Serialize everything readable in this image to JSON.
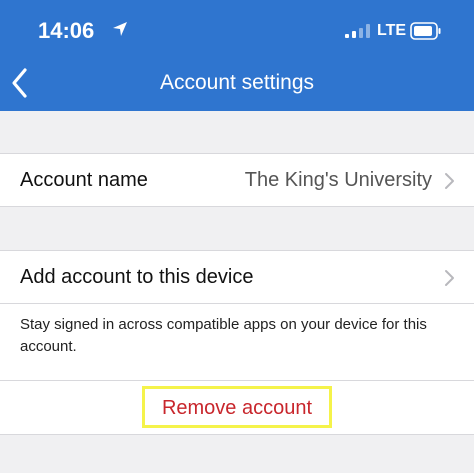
{
  "status_bar": {
    "time": "14:06",
    "network": "LTE"
  },
  "header": {
    "title": "Account settings"
  },
  "account_name_row": {
    "label": "Account name",
    "value": "The King's University"
  },
  "add_account_row": {
    "label": "Add account to this device"
  },
  "note": {
    "text": "Stay signed in across compatible apps on your device for this account."
  },
  "remove": {
    "label": "Remove account"
  },
  "colors": {
    "header_bg": "#2f75cf",
    "remove_text": "#c8262c",
    "highlight": "#f5f34a"
  },
  "icons": [
    "location-arrow-icon",
    "signal-bars-icon",
    "battery-icon",
    "back-chevron-icon",
    "chevron-right-icon"
  ]
}
